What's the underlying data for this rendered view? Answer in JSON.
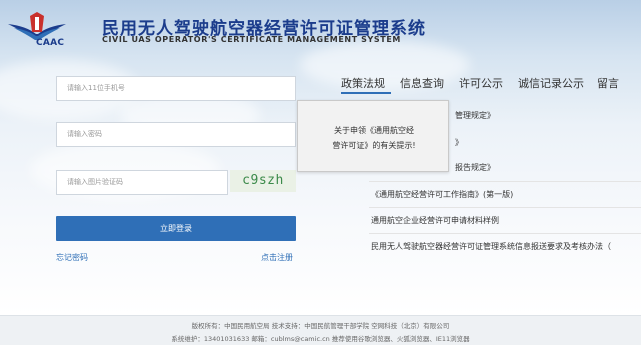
{
  "header": {
    "logo_text": "CAAC",
    "title_cn": "民用无人驾驶航空器经营许可证管理系统",
    "title_en": "CIVIL UAS OPERATOR'S CERTIFICATE MANAGEMENT SYSTEM"
  },
  "login": {
    "phone_placeholder": "请输入11位手机号",
    "password_placeholder": "请输入密码",
    "captcha_placeholder": "请输入图片验证码",
    "captcha_text": "c9szh",
    "login_label": "立即登录",
    "forgot_label": "忘记密码",
    "register_label": "点击注册"
  },
  "tabs": [
    {
      "label": "政策法规"
    },
    {
      "label": "信息查询"
    },
    {
      "label": "许可公示"
    },
    {
      "label": "诚信记录公示"
    },
    {
      "label": "留言"
    }
  ],
  "news": [
    {
      "title": "管理规定》"
    },
    {
      "title": "》"
    },
    {
      "title": "报告规定》"
    },
    {
      "title": "《通用航空经营许可工作指南》(第一版)"
    },
    {
      "title": "通用航空企业经营许可申请材料样例"
    },
    {
      "title": "民用无人驾驶航空器经营许可证管理系统信息报送要求及考核办法（"
    }
  ],
  "popup": {
    "line1": "关于申领《通用航空经",
    "line2": "营许可证》的有关提示!"
  },
  "footer": {
    "line1": "版权所有：中国民用航空局    技术支持：中国民航管理干部学院 空网科技（北京）有限公司",
    "line2": "系统维护：13401031633    邮箱：cublms@camic.cn    推荐使用谷歌浏览器、火狐浏览器、IE11浏览器"
  },
  "colors": {
    "brand": "#1b3c8c",
    "accent": "#2f6fb7",
    "captcha": "#3c8a4a"
  }
}
